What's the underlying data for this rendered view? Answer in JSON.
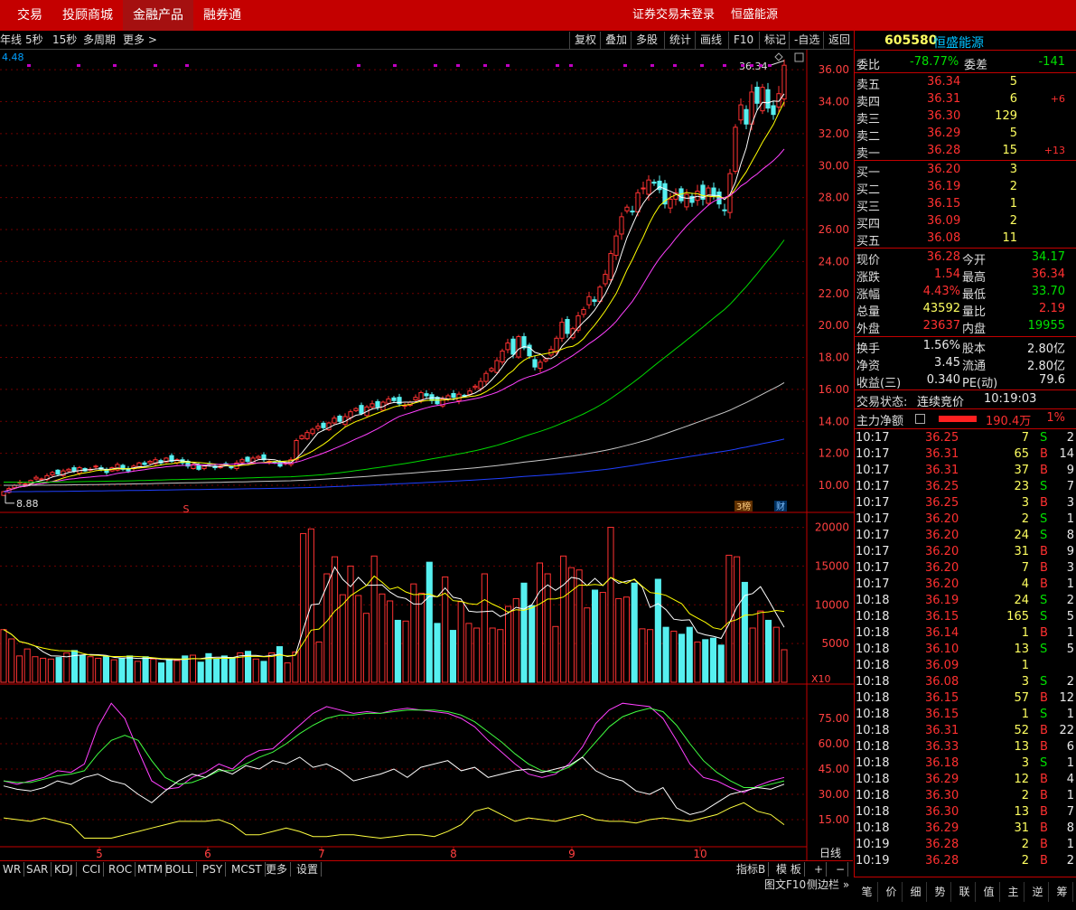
{
  "nav": {
    "tabs": [
      "交易",
      "投顾商城",
      "金融产品",
      "融券通"
    ],
    "active": 2,
    "status": "证券交易未登录",
    "stock": "恒盛能源"
  },
  "toolbar": {
    "left": [
      "年线",
      "5秒",
      "15秒",
      "多周期",
      "更多 >"
    ],
    "right": [
      "复权",
      "叠加",
      "多股",
      "统计",
      "画线",
      "F10",
      "标记",
      "-自选",
      "返回"
    ]
  },
  "chart": {
    "ma_label": "4.48",
    "price_axis": [
      36,
      34,
      32,
      30,
      28,
      26,
      24,
      22,
      20,
      18,
      16,
      14,
      12,
      10
    ],
    "price_min": 8.7,
    "price_max": 36.8,
    "high_label": "36.34",
    "low_label": "8.88",
    "closes": [
      9.6,
      9.8,
      10.0,
      10.2,
      10.1,
      10.3,
      10.5,
      10.4,
      10.6,
      10.8,
      10.7,
      10.9,
      11.0,
      10.9,
      11.1,
      10.9,
      11.0,
      11.2,
      11.0,
      10.8,
      11.1,
      11.3,
      11.0,
      10.9,
      11.2,
      11.4,
      11.3,
      11.5,
      11.6,
      11.4,
      11.7,
      11.5,
      11.6,
      11.4,
      11.2,
      11.3,
      11.0,
      11.2,
      11.3,
      11.1,
      11.2,
      11.3,
      11.1,
      11.4,
      11.6,
      11.5,
      11.7,
      11.8,
      11.6,
      11.5,
      11.4,
      11.2,
      11.4,
      11.6,
      12.8,
      13.1,
      13.3,
      13.5,
      13.7,
      13.6,
      13.9,
      14.2,
      14.0,
      14.3,
      14.6,
      14.8,
      14.5,
      14.9,
      15.1,
      14.9,
      15.2,
      15.4,
      15.3,
      15.1,
      15.0,
      15.2,
      15.5,
      15.8,
      15.6,
      15.3,
      15.1,
      15.4,
      15.6,
      15.5,
      15.7,
      15.6,
      15.9,
      16.2,
      16.5,
      17.0,
      17.3,
      17.8,
      18.4,
      18.9,
      18.2,
      19.3,
      18.6,
      18.1,
      17.4,
      17.7,
      17.9,
      18.5,
      19.2,
      20.2,
      19.5,
      19.8,
      20.6,
      21.0,
      21.8,
      21.5,
      22.4,
      23.2,
      24.5,
      25.6,
      26.8,
      27.4,
      27.1,
      28.3,
      28.6,
      29.1,
      28.9,
      28.5,
      27.6,
      27.9,
      28.3,
      27.8,
      28.2,
      27.7,
      28.4,
      27.9,
      28.6,
      28.1,
      27.6,
      27.2,
      29.5,
      32.4,
      33.8,
      32.6,
      34.6,
      33.9,
      34.9,
      33.6,
      33.2,
      34.5,
      36.28
    ],
    "volumes": [
      6800,
      5600,
      3400,
      4300,
      3300,
      3100,
      3000,
      3200,
      3800,
      4100,
      3500,
      3300,
      3100,
      3300,
      2900,
      3100,
      3400,
      2700,
      3300,
      3000,
      2500,
      3000,
      2800,
      3400,
      3500,
      2600,
      3700,
      3000,
      3400,
      3200,
      3800,
      4000,
      3000,
      2700,
      3800,
      4600,
      2500,
      3900,
      19200,
      19800,
      5200,
      14000,
      16200,
      11300,
      15000,
      11200,
      8900,
      16300,
      11400,
      10500,
      8000,
      7900,
      12700,
      11500,
      15500,
      7600,
      13600,
      6700,
      10400,
      7600,
      7000,
      14000,
      7000,
      6800,
      9800,
      10800,
      12800,
      9900,
      15400,
      14000,
      7200,
      16300,
      14800,
      14500,
      9600,
      11900,
      11600,
      20000,
      10800,
      11000,
      12800,
      6900,
      6800,
      13300,
      7100,
      6600,
      6200,
      7100,
      5200,
      5500,
      5700,
      4800,
      16400,
      16200,
      12900,
      7000,
      9200,
      8000,
      7100,
      4200
    ],
    "vol_axis": [
      20000,
      15000,
      10000,
      5000
    ],
    "vol_multiplier": "X10",
    "vol_max": 21000,
    "ind_axis": [
      75.0,
      60.0,
      45.0,
      30.0,
      15.0
    ],
    "ind_k": [
      38,
      36,
      38,
      40,
      44,
      43,
      48,
      70,
      84,
      75,
      56,
      38,
      33,
      34,
      40,
      43,
      48,
      45,
      52,
      56,
      57,
      64,
      71,
      78,
      82,
      80,
      78,
      79,
      78,
      80,
      81,
      80,
      79,
      78,
      75,
      70,
      62,
      55,
      48,
      42,
      40,
      42,
      48,
      58,
      72,
      80,
      84,
      83,
      82,
      75,
      62,
      48,
      40,
      38,
      34,
      31,
      35,
      38,
      40
    ],
    "ind_d": [
      38,
      37,
      37,
      39,
      41,
      42,
      44,
      54,
      62,
      65,
      62,
      50,
      40,
      36,
      37,
      40,
      44,
      44,
      48,
      52,
      55,
      60,
      66,
      71,
      75,
      77,
      77,
      78,
      78,
      79,
      80,
      80,
      80,
      79,
      77,
      73,
      67,
      61,
      54,
      48,
      44,
      43,
      46,
      52,
      61,
      70,
      76,
      79,
      81,
      79,
      71,
      60,
      50,
      43,
      38,
      34,
      34,
      36,
      38
    ],
    "ind_j": [
      35,
      33,
      32,
      34,
      38,
      36,
      40,
      42,
      38,
      36,
      30,
      25,
      32,
      38,
      42,
      40,
      45,
      42,
      47,
      45,
      50,
      48,
      52,
      46,
      48,
      44,
      38,
      40,
      42,
      45,
      40,
      46,
      48,
      50,
      44,
      46,
      40,
      42,
      44,
      45,
      43,
      45,
      47,
      52,
      44,
      40,
      38,
      32,
      30,
      34,
      22,
      18,
      20,
      25,
      30,
      32,
      34,
      33,
      36
    ],
    "ind_e": [
      16,
      15,
      14,
      16,
      14,
      12,
      4,
      4,
      4,
      6,
      8,
      10,
      12,
      14,
      14,
      14,
      15,
      12,
      6,
      6,
      8,
      10,
      8,
      5,
      5,
      6,
      6,
      5,
      4,
      5,
      6,
      6,
      5,
      8,
      12,
      20,
      22,
      18,
      14,
      16,
      15,
      14,
      16,
      18,
      15,
      14,
      14,
      13,
      15,
      16,
      15,
      14,
      16,
      18,
      22,
      25,
      20,
      18,
      12
    ],
    "x_labels": [
      "5",
      "6",
      "7",
      "8",
      "9",
      "10"
    ],
    "tf_label": "日线",
    "s_marker": "S",
    "badges": [
      "3榜",
      "财"
    ],
    "colors": {
      "up": "#ff3232",
      "down": "#56f0f0",
      "ma5": "#ffffff",
      "ma10": "#ffff00",
      "ma20": "#ff40ff",
      "ma60": "#00d800",
      "ma120": "#c8c8c8",
      "ma250": "#2040ff",
      "grid": "#700000"
    }
  },
  "quote": {
    "code": "605580",
    "name": "恒盛能源",
    "webi_label": "委比",
    "webi": "-78.77%",
    "weicha_label": "委差",
    "weicha": "-141",
    "asks": [
      {
        "label": "卖五",
        "price": "36.34",
        "vol": "5",
        "chg": ""
      },
      {
        "label": "卖四",
        "price": "36.31",
        "vol": "6",
        "chg": "+6"
      },
      {
        "label": "卖三",
        "price": "36.30",
        "vol": "129",
        "chg": ""
      },
      {
        "label": "卖二",
        "price": "36.29",
        "vol": "5",
        "chg": ""
      },
      {
        "label": "卖一",
        "price": "36.28",
        "vol": "15",
        "chg": "+13"
      }
    ],
    "bids": [
      {
        "label": "买一",
        "price": "36.20",
        "vol": "3"
      },
      {
        "label": "买二",
        "price": "36.19",
        "vol": "2"
      },
      {
        "label": "买三",
        "price": "36.15",
        "vol": "1"
      },
      {
        "label": "买四",
        "price": "36.09",
        "vol": "2"
      },
      {
        "label": "买五",
        "price": "36.08",
        "vol": "11"
      }
    ],
    "stats": [
      {
        "l1": "现价",
        "v1": "36.28",
        "c1": "red",
        "l2": "今开",
        "v2": "34.17",
        "c2": "green"
      },
      {
        "l1": "涨跌",
        "v1": "1.54",
        "c1": "red",
        "l2": "最高",
        "v2": "36.34",
        "c2": "red"
      },
      {
        "l1": "涨幅",
        "v1": "4.43%",
        "c1": "red",
        "l2": "最低",
        "v2": "33.70",
        "c2": "green"
      },
      {
        "l1": "总量",
        "v1": "43592",
        "c1": "yellow",
        "l2": "量比",
        "v2": "2.19",
        "c2": "red"
      },
      {
        "l1": "外盘",
        "v1": "23637",
        "c1": "red",
        "l2": "内盘",
        "v2": "19955",
        "c2": "green"
      }
    ],
    "stats2": [
      {
        "l1": "换手",
        "v1": "1.56%",
        "l2": "股本",
        "v2": "2.80亿"
      },
      {
        "l1": "净资",
        "v1": "3.45",
        "l2": "流通",
        "v2": "2.80亿"
      },
      {
        "l1": "收益(三)",
        "v1": "0.340",
        "l2": "PE(动)",
        "v2": "79.6"
      }
    ],
    "status_label": "交易状态:",
    "status_value": "连续竞价",
    "status_time": "10:19:03",
    "flow_label": "主力净额",
    "flow_value": "190.4万",
    "flow_pct": "1%"
  },
  "ticks": [
    [
      "10:17",
      "36.25",
      "7",
      "S",
      "2"
    ],
    [
      "10:17",
      "36.31",
      "65",
      "B",
      "14"
    ],
    [
      "10:17",
      "36.31",
      "37",
      "B",
      "9"
    ],
    [
      "10:17",
      "36.25",
      "23",
      "S",
      "7"
    ],
    [
      "10:17",
      "36.25",
      "3",
      "B",
      "3"
    ],
    [
      "10:17",
      "36.20",
      "2",
      "S",
      "1"
    ],
    [
      "10:17",
      "36.20",
      "24",
      "S",
      "8"
    ],
    [
      "10:17",
      "36.20",
      "31",
      "B",
      "9"
    ],
    [
      "10:17",
      "36.20",
      "7",
      "B",
      "3"
    ],
    [
      "10:17",
      "36.20",
      "4",
      "B",
      "1"
    ],
    [
      "10:18",
      "36.19",
      "24",
      "S",
      "2"
    ],
    [
      "10:18",
      "36.15",
      "165",
      "S",
      "5"
    ],
    [
      "10:18",
      "36.14",
      "1",
      "B",
      "1"
    ],
    [
      "10:18",
      "36.10",
      "13",
      "S",
      "5"
    ],
    [
      "10:18",
      "36.09",
      "1",
      "",
      ""
    ],
    [
      "10:18",
      "36.08",
      "3",
      "S",
      "2"
    ],
    [
      "10:18",
      "36.15",
      "57",
      "B",
      "12"
    ],
    [
      "10:18",
      "36.15",
      "1",
      "S",
      "1"
    ],
    [
      "10:18",
      "36.31",
      "52",
      "B",
      "22"
    ],
    [
      "10:18",
      "36.33",
      "13",
      "B",
      "6"
    ],
    [
      "10:18",
      "36.18",
      "3",
      "S",
      "1"
    ],
    [
      "10:18",
      "36.29",
      "12",
      "B",
      "4"
    ],
    [
      "10:18",
      "36.30",
      "2",
      "B",
      "1"
    ],
    [
      "10:18",
      "36.30",
      "13",
      "B",
      "7"
    ],
    [
      "10:18",
      "36.29",
      "31",
      "B",
      "8"
    ],
    [
      "10:19",
      "36.28",
      "2",
      "B",
      "1"
    ],
    [
      "10:19",
      "36.28",
      "2",
      "B",
      "2"
    ]
  ],
  "bottom": {
    "tabs": [
      "WR",
      "SAR",
      "KDJ",
      "CCI",
      "ROC",
      "MTM",
      "BOLL",
      "PSY",
      "MCST",
      "更多",
      "设置"
    ],
    "right": [
      "指标B",
      "模 板",
      "+",
      "−"
    ],
    "f10": "图文F10",
    "sidebar": "侧边栏 »"
  },
  "side_tabs": [
    "笔",
    "价",
    "细",
    "势",
    "联",
    "值",
    "主",
    "逆",
    "筹"
  ]
}
